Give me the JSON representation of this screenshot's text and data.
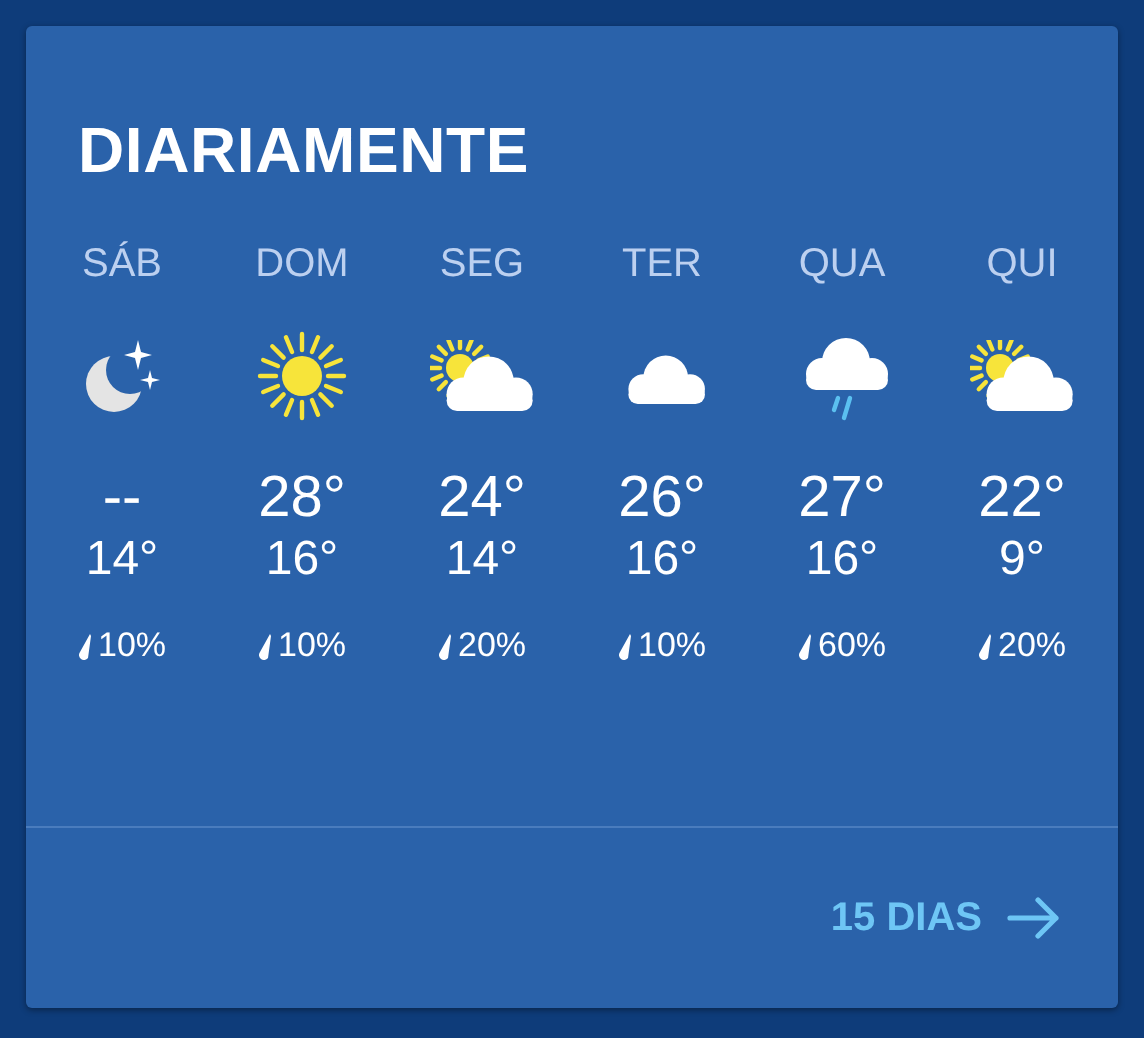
{
  "title": "DIARIAMENTE",
  "days": [
    {
      "day": "SÁB",
      "kind": "night",
      "high": "--",
      "low": "14°",
      "precip": "10%"
    },
    {
      "day": "DOM",
      "kind": "sunny",
      "high": "28°",
      "low": "16°",
      "precip": "10%"
    },
    {
      "day": "SEG",
      "kind": "partly_cloudy",
      "high": "24°",
      "low": "14°",
      "precip": "20%"
    },
    {
      "day": "TER",
      "kind": "cloudy",
      "high": "26°",
      "low": "16°",
      "precip": "10%"
    },
    {
      "day": "QUA",
      "kind": "rain",
      "high": "27°",
      "low": "16°",
      "precip": "60%"
    },
    {
      "day": "QUI",
      "kind": "partly_cloudy",
      "high": "22°",
      "low": "9°",
      "precip": "20%"
    }
  ],
  "footer_link": "15 DIAS"
}
